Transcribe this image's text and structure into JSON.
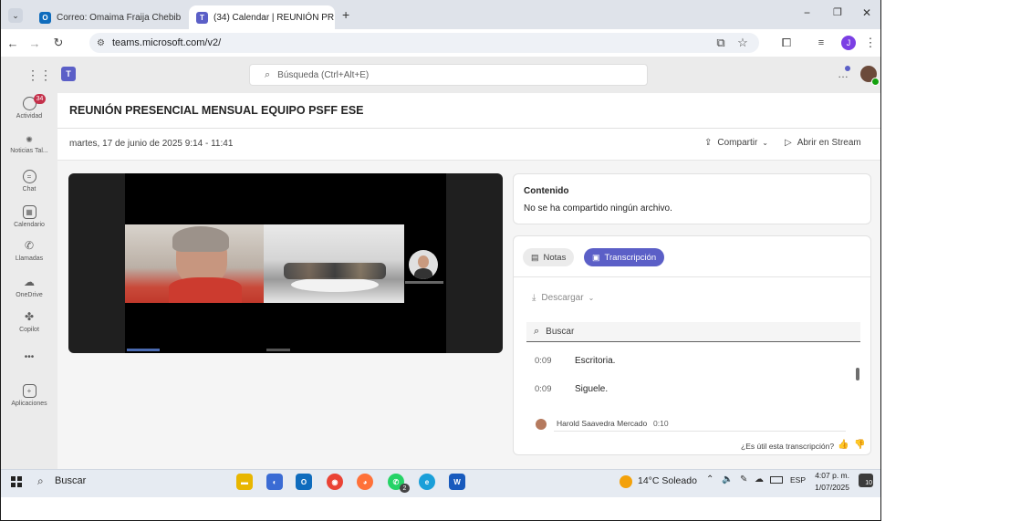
{
  "browser": {
    "tabs": [
      {
        "label": "Correo: Omaima Fraija Chebib",
        "icon": "outlook-icon"
      },
      {
        "label": "(34) Calendar | REUNIÓN PR",
        "icon": "teams-icon"
      }
    ],
    "url": "teams.microsoft.com/v2/"
  },
  "teams": {
    "search_placeholder": "Búsqueda (Ctrl+Alt+E)",
    "rail": [
      {
        "label": "Actividad",
        "badge": "34"
      },
      {
        "label": "Noticias Tal..."
      },
      {
        "label": "Chat"
      },
      {
        "label": "Calendario"
      },
      {
        "label": "Llamadas"
      },
      {
        "label": "OneDrive"
      },
      {
        "label": "Copilot"
      },
      {
        "label": "•••"
      },
      {
        "label": "Aplicaciones"
      }
    ]
  },
  "meeting": {
    "title": "REUNIÓN PRESENCIAL MENSUAL EQUIPO PSFF ESE",
    "datetime": "martes, 17 de junio de 2025 9:14 - 11:41",
    "share_label": "Compartir",
    "stream_label": "Abrir en Stream"
  },
  "content_card": {
    "heading": "Contenido",
    "text": "No se ha compartido ningún archivo."
  },
  "transcript_panel": {
    "tabs": [
      {
        "label": "Notas",
        "active": false
      },
      {
        "label": "Transcripción",
        "active": true
      }
    ],
    "download_label": "Descargar",
    "search_placeholder": "Buscar",
    "entries": [
      {
        "time": "0:09",
        "text": "Escritoria."
      },
      {
        "time": "0:09",
        "text": "Siguele."
      }
    ],
    "speaker": {
      "name": "Harold Saavedra Mercado",
      "time": "0:10"
    },
    "feedback_question": "¿Es útil esta transcripción?"
  },
  "taskbar": {
    "search_label": "Buscar",
    "weather": "14°C Soleado",
    "language": "ESP",
    "time": "4:07 p. m.",
    "date": "1/07/2025",
    "notifications": "10",
    "whatsapp_badge": "2"
  },
  "colors": {
    "accent": "#5b5fc7",
    "titlebar": "#dfe3ea"
  }
}
